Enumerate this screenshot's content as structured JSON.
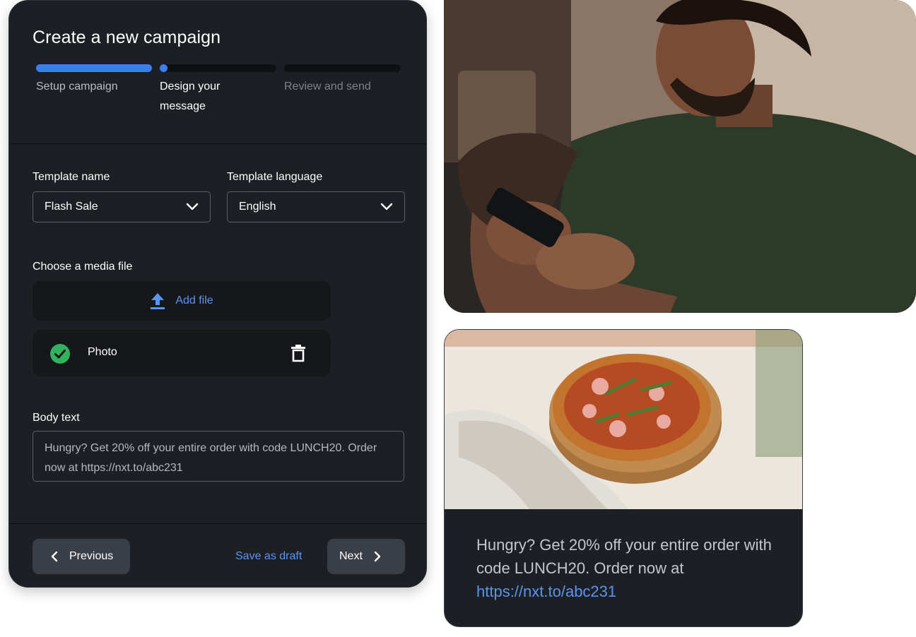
{
  "campaign": {
    "title": "Create a new campaign",
    "steps": [
      {
        "label": "Setup campaign",
        "status": "complete"
      },
      {
        "label": "Design your message",
        "status": "current"
      },
      {
        "label": "Review and send",
        "status": "upcoming"
      }
    ],
    "template_name": {
      "label": "Template name",
      "value": "Flash Sale"
    },
    "template_language": {
      "label": "Template language",
      "value": "English"
    },
    "media": {
      "label": "Choose a media file",
      "add_file_label": "Add file",
      "files": [
        {
          "name": "Photo",
          "status": "uploaded"
        }
      ]
    },
    "body": {
      "label": "Body text",
      "value": "Hungry? Get 20% off your entire order with code LUNCH20. Order now at https://nxt.to/abc231"
    },
    "footer": {
      "previous_label": "Previous",
      "save_draft_label": "Save as draft",
      "next_label": "Next"
    }
  },
  "preview": {
    "message_text": "Hungry? Get 20% off your entire order with code LUNCH20. Order now at",
    "link": "https://nxt.to/abc231"
  },
  "colors": {
    "card_bg": "#1c1f24",
    "accent_blue": "#3a7ff2",
    "link_blue": "#5b94f0",
    "success_green": "#2fb35c"
  },
  "icons": {
    "dropdown": "chevron-down-icon",
    "upload": "upload-icon",
    "uploaded": "check-circle-icon",
    "delete": "trash-icon",
    "previous": "chevron-left-icon",
    "next": "chevron-right-icon"
  }
}
